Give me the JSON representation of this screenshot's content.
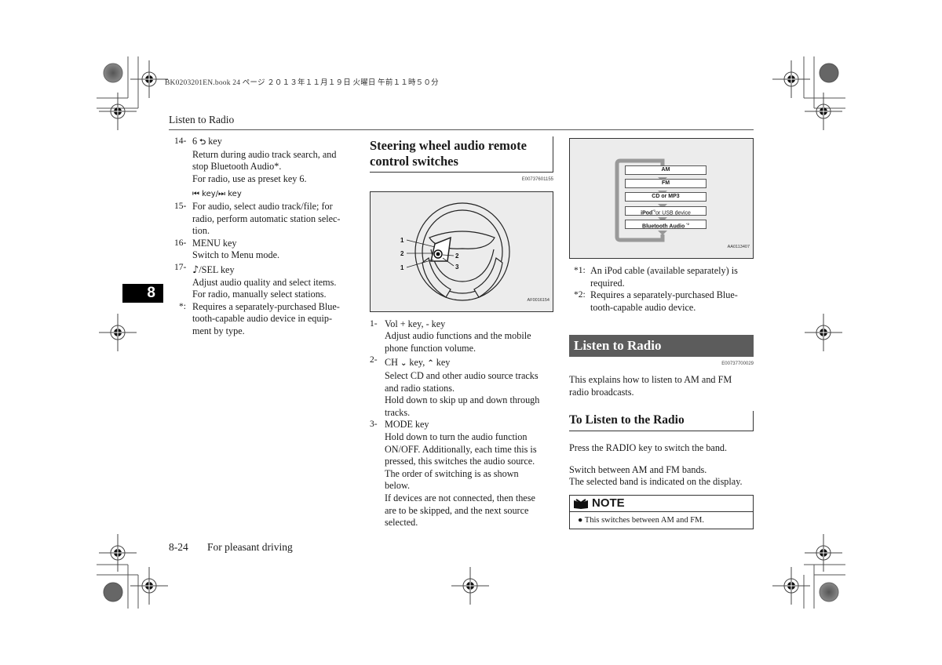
{
  "print_header": "BK0203201EN.book  24 ページ  ２０１３年１１月１９日  火曜日  午前１１時５０分",
  "running_head": "Listen to Radio",
  "chapter_tab": "8",
  "column1": {
    "items": [
      {
        "num": "14-",
        "title_prefix": "6",
        "title_icon": "return-arrow-icon",
        "title_glyph": "⮌",
        "title_suffix": "key",
        "lines": [
          "Return during audio track search, and",
          "stop Bluetooth Audio*.",
          "For radio, use as preset key 6."
        ]
      },
      {
        "num": "",
        "title_prefix": "",
        "title_icon": "skip-track-icon",
        "title_glyph": "⏮ key/⏭ key",
        "title_suffix": "",
        "lines": []
      },
      {
        "num": "15-",
        "lines": [
          "For audio, select audio track/file; for",
          "radio, perform automatic station selec-",
          "tion."
        ]
      },
      {
        "num": "16-",
        "title": "MENU key",
        "lines": [
          "Switch to Menu mode."
        ]
      },
      {
        "num": "17-",
        "title_icon": "note-icon",
        "title_glyph": "♪",
        "title_suffix": "/SEL key",
        "lines": [
          "Adjust audio quality and select items.",
          "For radio, manually select stations."
        ]
      },
      {
        "num": "*:",
        "lines": [
          "Requires a separately-purchased Blue-",
          "tooth-capable audio device in equip-",
          "ment by type."
        ]
      }
    ]
  },
  "column2": {
    "heading": "Steering wheel audio remote control switches",
    "heading_line1": "Steering wheel audio remote",
    "heading_line2": "control switches",
    "heading_code": "E00737601155",
    "figure_code": "AF0016154",
    "figure_labels": [
      "1",
      "2",
      "1",
      "2",
      "3"
    ],
    "items": [
      {
        "num": "1-",
        "title": "Vol + key, - key",
        "lines": [
          "Adjust audio functions and the mobile",
          "phone function volume."
        ]
      },
      {
        "num": "2-",
        "title_prefix": "CH",
        "title_mid": "key,",
        "title_suffix": "key",
        "lines": [
          "Select CD and other audio source tracks",
          "and radio stations.",
          "Hold down to skip up and down through",
          "tracks."
        ]
      },
      {
        "num": "3-",
        "title": "MODE key",
        "lines": [
          "Hold down to turn the audio function",
          "ON/OFF. Additionally, each time this is",
          "pressed, this switches the audio source.",
          "The order of switching is as shown",
          "below.",
          "If devices are not connected, then these",
          "are to be skipped, and the next source",
          "selected."
        ]
      }
    ]
  },
  "column3": {
    "flow": [
      "AM",
      "FM",
      "CD or MP3",
      "iPod*1 or USB device",
      "Bluetooth Audio *2"
    ],
    "flow_labels": {
      "ipod": "iPod",
      "ipod_sup": "*1",
      "usb": "or USB device",
      "bt": "Bluetooth Audio",
      "bt_sup": "*2"
    },
    "figure_code": "AA0113407",
    "footnotes": [
      {
        "mark": "*1:",
        "lines": [
          "An iPod cable (available separately) is",
          "required."
        ]
      },
      {
        "mark": "*2:",
        "lines": [
          "Requires a separately-purchased Blue-",
          "tooth-capable audio device."
        ]
      }
    ],
    "band_heading": "Listen to Radio",
    "band_code": "E00737700029",
    "intro_lines": [
      "This explains how to listen to AM and FM",
      "radio broadcasts."
    ],
    "sub_heading": "To Listen to the Radio",
    "para1": "Press the RADIO key to switch the band.",
    "para2_lines": [
      "Switch between AM and FM bands.",
      "The selected band is indicated on the display."
    ],
    "note_title": "NOTE",
    "note_text": "● This switches between AM and FM."
  },
  "footer": {
    "page": "8-24",
    "section": "For pleasant driving"
  }
}
